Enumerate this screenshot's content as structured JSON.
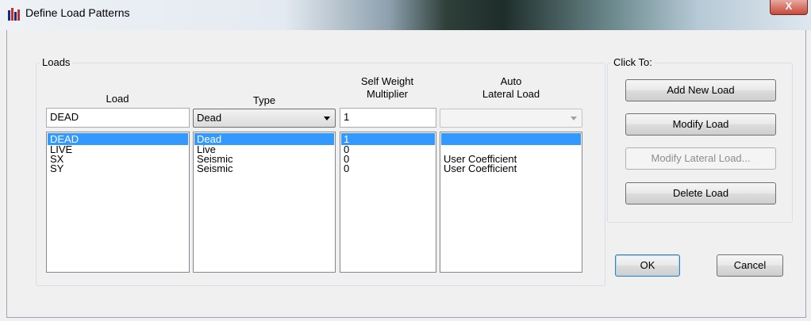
{
  "window": {
    "title": "Define Load Patterns",
    "close_label": "X"
  },
  "loads_group": {
    "label": "Loads",
    "headers": {
      "load": "Load",
      "type": "Type",
      "self_weight": "Self Weight\nMultiplier",
      "auto_lateral": "Auto\nLateral Load"
    },
    "edit_row": {
      "load": "DEAD",
      "type": "Dead",
      "self_weight": "1",
      "auto_lateral": ""
    },
    "selected_index": 0,
    "rows": [
      {
        "load": "DEAD",
        "type": "Dead",
        "self_weight": "1",
        "auto_lateral": ""
      },
      {
        "load": "LIVE",
        "type": "Live",
        "self_weight": "0",
        "auto_lateral": ""
      },
      {
        "load": "SX",
        "type": "Seismic",
        "self_weight": "0",
        "auto_lateral": "User Coefficient"
      },
      {
        "load": "SY",
        "type": "Seismic",
        "self_weight": "0",
        "auto_lateral": "User Coefficient"
      }
    ]
  },
  "click_to": {
    "label": "Click To:",
    "add_new_load": "Add New Load",
    "modify_load": "Modify Load",
    "modify_lateral_load": "Modify Lateral Load...",
    "delete_load": "Delete Load"
  },
  "footer": {
    "ok": "OK",
    "cancel": "Cancel"
  },
  "colors": {
    "selection": "#3399ff",
    "dialog_bg": "#f0f0f0"
  }
}
